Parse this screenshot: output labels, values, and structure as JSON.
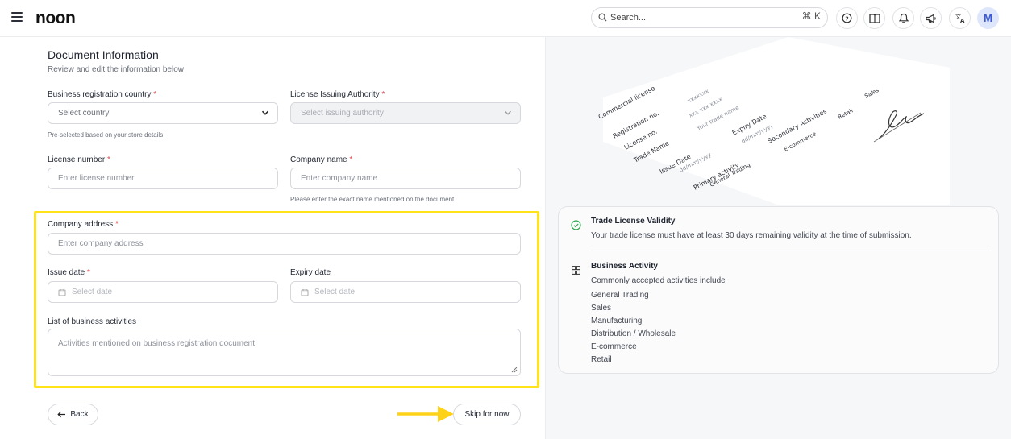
{
  "header": {
    "logo": "noon",
    "search_placeholder": "Search...",
    "search_shortcut": "⌘ K",
    "avatar_initial": "M"
  },
  "form": {
    "title": "Document Information",
    "subtitle": "Review and edit the information below",
    "country_label": "Business registration country",
    "country_placeholder": "Select country",
    "country_hint": "Pre-selected based on your store details.",
    "authority_label": "License Issuing Authority",
    "authority_placeholder": "Select issuing authority",
    "license_label": "License number",
    "license_placeholder": "Enter license number",
    "company_label": "Company name",
    "company_placeholder": "Enter company name",
    "company_hint": "Please enter the exact name mentioned on the document.",
    "address_label": "Company address",
    "address_placeholder": "Enter company address",
    "issue_label": "Issue date",
    "issue_placeholder": "Select date",
    "expiry_label": "Expiry date",
    "expiry_placeholder": "Select date",
    "activities_label": "List of business activities",
    "activities_placeholder": "Activities mentioned on business registration document",
    "required_mark": "*",
    "back_label": "Back",
    "skip_label": "Skip for now"
  },
  "illustration": {
    "commercial_license": "Commercial license",
    "xxxx": "xxxxxxx",
    "registration": "Registration no.",
    "reg_value": "xxx xxx xxxx",
    "license_no": "License no.",
    "trade_name_value": "Your trade name",
    "trade_name": "Trade Name",
    "expiry_date": "Expiry Date",
    "expiry_value": "dd/mm/yyyy",
    "issue_date": "Issue Date",
    "issue_value": "dd/mm/yyyy",
    "secondary": "Secondary Activities",
    "ecommerce": "E-commerce",
    "retail": "Retail",
    "sales": "Sales",
    "primary": "Primary activity",
    "general": "General Trading"
  },
  "info": {
    "validity_title": "Trade License Validity",
    "validity_text": "Your trade license must have at least 30 days remaining validity at the time of submission.",
    "activity_title": "Business Activity",
    "activity_intro": "Commonly accepted activities include",
    "activities": [
      "General Trading",
      "Sales",
      "Manufacturing",
      "Distribution / Wholesale",
      "E-commerce",
      "Retail"
    ]
  },
  "colors": {
    "highlight": "#ffe21a",
    "accent": "#3b5bd6",
    "required": "#e2474a"
  }
}
